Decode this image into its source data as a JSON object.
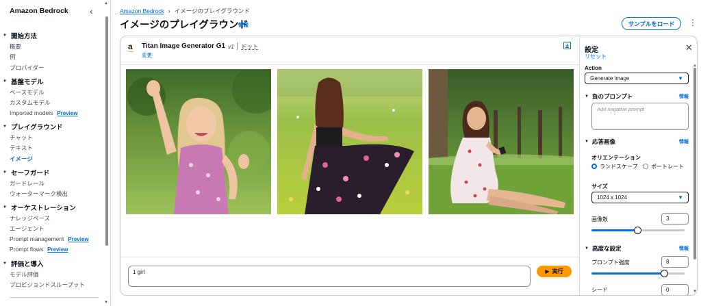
{
  "sidebar": {
    "title": "Amazon Bedrock",
    "sections": [
      {
        "title": "開始方法",
        "items": [
          {
            "label": "概要"
          },
          {
            "label": "例"
          },
          {
            "label": "プロバイダー"
          }
        ]
      },
      {
        "title": "基盤モデル",
        "items": [
          {
            "label": "ベースモデル"
          },
          {
            "label": "カスタムモデル"
          },
          {
            "label": "Imported models",
            "badge": "Preview"
          }
        ]
      },
      {
        "title": "プレイグラウンド",
        "items": [
          {
            "label": "チャット"
          },
          {
            "label": "テキスト"
          },
          {
            "label": "イメージ",
            "active": true
          }
        ]
      },
      {
        "title": "セーフガード",
        "items": [
          {
            "label": "ガードレール"
          },
          {
            "label": "ウォーターマーク検出"
          }
        ]
      },
      {
        "title": "オーケストレーション",
        "items": [
          {
            "label": "ナレッジベース"
          },
          {
            "label": "エージェント"
          },
          {
            "label": "Prompt management",
            "badge": "Preview"
          },
          {
            "label": "Prompt flows",
            "badge": "Preview"
          }
        ]
      },
      {
        "title": "評価と導入",
        "items": [
          {
            "label": "モデル評価"
          },
          {
            "label": "プロビジョンドスループット"
          }
        ]
      }
    ]
  },
  "header": {
    "breadcrumb": {
      "root": "Amazon Bedrock",
      "current": "イメージのプレイグラウンド"
    },
    "title": "イメージのプレイグラウンド",
    "info": "情報",
    "sample_button": "サンプルをロード"
  },
  "model": {
    "logo": "a",
    "name": "Titan Image Generator G1",
    "version": "v1",
    "mode": "ドット",
    "change": "変更"
  },
  "images": [
    {
      "alt": "girl waving in field"
    },
    {
      "alt": "woman in floral skirt"
    },
    {
      "alt": "woman sitting on grass with phone"
    }
  ],
  "prompt": {
    "value": "1 girl",
    "run_label": "実行"
  },
  "settings": {
    "title": "設定",
    "reset": "リセット",
    "action_label": "Action",
    "action_value": "Generate image",
    "negative_prompt": {
      "title": "負のプロンプト",
      "info": "情報",
      "placeholder": "Add negative prompt"
    },
    "response_image": {
      "title": "応答画像",
      "info": "情報",
      "orientation_label": "オリエンテーション",
      "orientation_options": [
        "ランドスケープ",
        "ポートレート"
      ],
      "orientation_selected": "ランドスケープ",
      "size_label": "サイズ",
      "size_value": "1024 x 1024",
      "count_label": "画像数",
      "count_value": "3",
      "count_fraction": 0.5
    },
    "advanced": {
      "title": "高度な設定",
      "info": "情報",
      "prompt_strength_label": "プロンプト強度",
      "prompt_strength_value": "8",
      "prompt_strength_fraction": 0.79,
      "seed_label": "シード",
      "seed_value": "0"
    }
  }
}
